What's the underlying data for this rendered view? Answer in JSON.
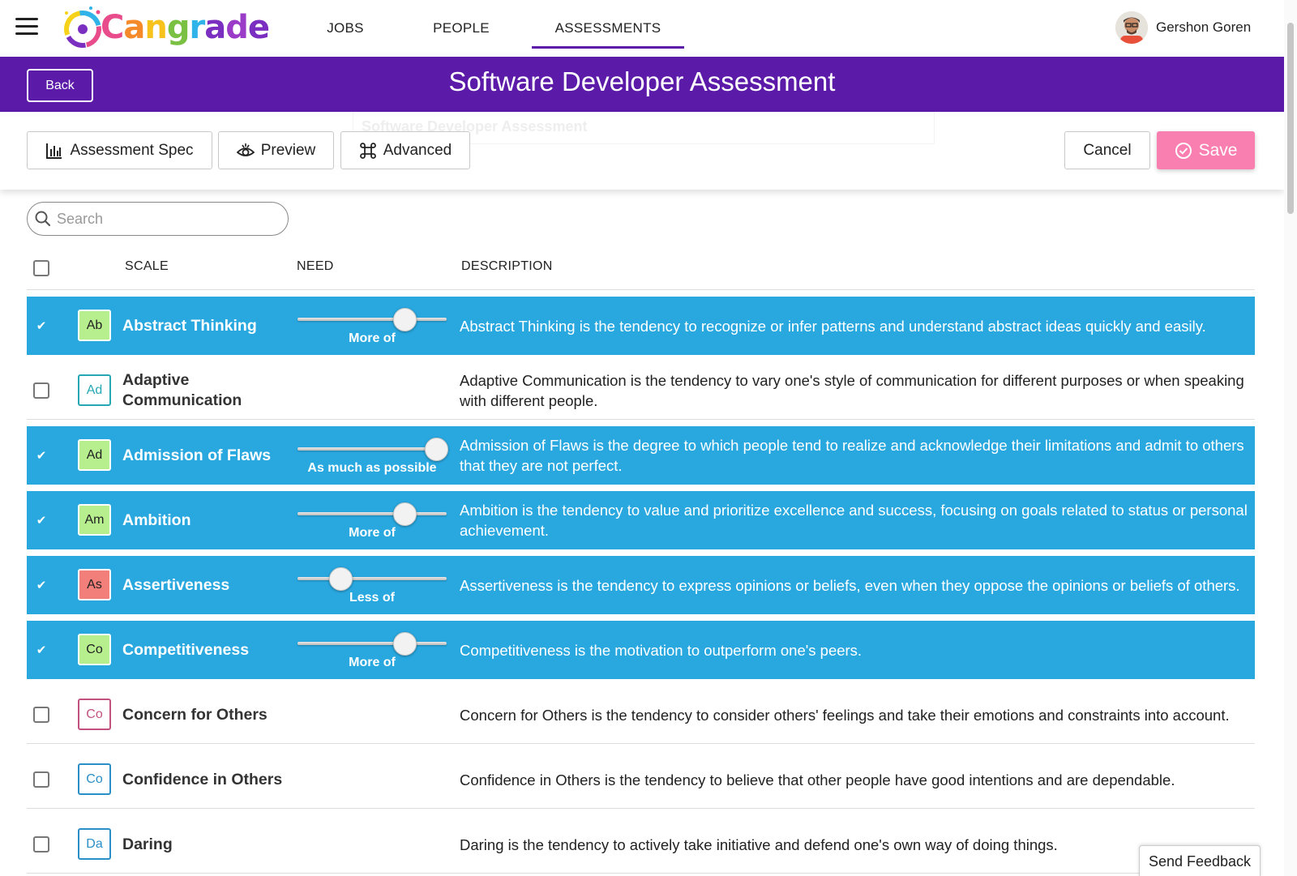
{
  "app": {
    "logo_text": "Cangrade",
    "colors": {
      "purple": "#5b1aa8",
      "blue": "#29a8e0",
      "pink": "#fa7fb1"
    }
  },
  "nav": {
    "tabs": [
      {
        "label": "JOBS",
        "active": false
      },
      {
        "label": "PEOPLE",
        "active": false
      },
      {
        "label": "ASSESSMENTS",
        "active": true
      }
    ],
    "user_name": "Gershon Goren"
  },
  "banner": {
    "back_label": "Back",
    "title": "Software Developer Assessment"
  },
  "toolbar": {
    "ghost_title": "Software Developer Assessment",
    "spec_label": "Assessment Spec",
    "preview_label": "Preview",
    "advanced_label": "Advanced",
    "cancel_label": "Cancel",
    "save_label": "Save"
  },
  "search": {
    "placeholder": "Search"
  },
  "table": {
    "headers": {
      "scale": "SCALE",
      "need": "NEED",
      "description": "DESCRIPTION"
    },
    "rows": [
      {
        "abbr": "Ab",
        "name": "Abstract Thinking",
        "selected": true,
        "badge_color": "#b7ef8e",
        "need_label": "More of",
        "need_level": 0.72,
        "description": "Abstract Thinking is the tendency to recognize or infer patterns and understand abstract ideas quickly and easily."
      },
      {
        "abbr": "Ad",
        "name": "Adaptive Communication",
        "selected": false,
        "badge_color": "#26a7b4",
        "need_label": "",
        "need_level": null,
        "description": "Adaptive Communication is the tendency to vary one's style of communication for different purposes or when speaking with different people."
      },
      {
        "abbr": "Ad",
        "name": "Admission of Flaws",
        "selected": true,
        "badge_color": "#b7ef8e",
        "need_label": "As much as possible",
        "need_level": 0.93,
        "description": "Admission of Flaws is the degree to which people tend to realize and acknowledge their limitations and admit to others that they are not perfect."
      },
      {
        "abbr": "Am",
        "name": "Ambition",
        "selected": true,
        "badge_color": "#b7ef8e",
        "need_label": "More of",
        "need_level": 0.72,
        "description": "Ambition is the tendency to value and prioritize excellence and success, focusing on goals related to status or personal achievement."
      },
      {
        "abbr": "As",
        "name": "Assertiveness",
        "selected": true,
        "badge_color": "#f37f7b",
        "need_label": "Less of",
        "need_level": 0.29,
        "description": "Assertiveness is the tendency to express opinions or beliefs, even when they oppose the opinions or beliefs of others."
      },
      {
        "abbr": "Co",
        "name": "Competitiveness",
        "selected": true,
        "badge_color": "#b7ef8e",
        "need_label": "More of",
        "need_level": 0.72,
        "description": "Competitiveness is the motivation to outperform one's peers."
      },
      {
        "abbr": "Co",
        "name": "Concern for Others",
        "selected": false,
        "badge_color": "#c3517f",
        "need_label": "",
        "need_level": null,
        "description": "Concern for Others is the tendency to consider others' feelings and take their emotions and constraints into account."
      },
      {
        "abbr": "Co",
        "name": "Confidence in Others",
        "selected": false,
        "badge_color": "#2a8fc6",
        "need_label": "",
        "need_level": null,
        "description": "Confidence in Others is the tendency to believe that other people have good intentions and are dependable."
      },
      {
        "abbr": "Da",
        "name": "Daring",
        "selected": false,
        "badge_color": "#2a8fc6",
        "need_label": "",
        "need_level": null,
        "description": "Daring is the tendency to actively take initiative and defend one's own way of doing things."
      }
    ]
  },
  "feedback_label": "Send Feedback"
}
